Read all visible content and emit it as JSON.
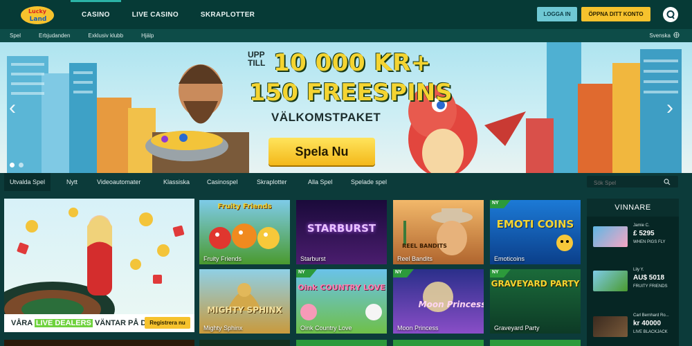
{
  "brand": {
    "logo_text": "Lucky Land"
  },
  "header": {
    "nav": [
      "CASINO",
      "LIVE CASINO",
      "SKRAPLOTTER"
    ],
    "login_label": "LOGGA IN",
    "open_account_label": "ÖPPNA DITT KONTO"
  },
  "subnav": {
    "items": [
      "Spel",
      "Erbjudanden",
      "Exklusiv klubb",
      "Hjälp"
    ],
    "language": "Svenska"
  },
  "hero": {
    "upp": "UPP",
    "till": "TILL",
    "line1": "10 000 KR+",
    "line2": "150 FREESPINS",
    "sub": "VÄLKOMSTPAKET",
    "cta": "Spela Nu"
  },
  "categories": {
    "tabs": [
      "Utvalda Spel",
      "Nytt",
      "Videoautomater",
      "Klassiska",
      "Casinospel",
      "Skraplotter",
      "Alla Spel",
      "Spelade spel"
    ],
    "search_placeholder": "Sök Spel"
  },
  "feature": {
    "text_before": "VÅRA ",
    "text_highlight": "LIVE DEALERS",
    "text_after": " VÄNTAR PÅ DIG",
    "register": "Registrera nu"
  },
  "games": [
    {
      "label": "Fruity Friends",
      "art": "Fruity Friends",
      "new": false
    },
    {
      "label": "Starburst",
      "art": "STARBURST",
      "new": false
    },
    {
      "label": "Reel Bandits",
      "art": "REEL BANDITS",
      "new": false
    },
    {
      "label": "Emoticoins",
      "art": "EMOTI COINS",
      "new": true
    },
    {
      "label": "Mighty Sphinx",
      "art": "MIGHTY SPHINX",
      "new": false
    },
    {
      "label": "Oink Country Love",
      "art": "Oink COUNTRY LOVE",
      "new": true
    },
    {
      "label": "Moon Princess",
      "art": "Moon Princess",
      "new": true
    },
    {
      "label": "Graveyard Party",
      "art": "GRAVEYARD PARTY",
      "new": true
    }
  ],
  "new_badge": "NY",
  "winners": {
    "title": "VINNARE",
    "list": [
      {
        "name": "Jamie C.",
        "amount": "£ 5295",
        "game": "WHEN PIGS FLY"
      },
      {
        "name": "Lily Y.",
        "amount": "AU$ 5018",
        "game": "FRUITY FRIENDS"
      },
      {
        "name": "Carl Bernhard Ro...",
        "amount": "kr 40000",
        "game": "LIVE BLACKJACK"
      }
    ]
  },
  "colors": {
    "header_bg": "#063a36",
    "accent_teal": "#2bb3a6",
    "login_button": "#6fc8d4",
    "cta_yellow": "#f6c22d",
    "new_badge": "#2c9a3b"
  },
  "icons": {
    "chat": "chat-bubble-icon",
    "language": "globe-icon",
    "search": "search-icon",
    "prev": "chevron-left-icon",
    "next": "chevron-right-icon"
  }
}
